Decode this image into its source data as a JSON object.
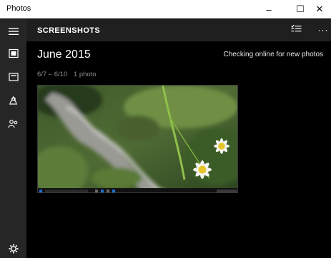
{
  "window": {
    "title": "Photos",
    "minimize_glyph": "–",
    "maximize_glyph": "☐",
    "close_glyph": "✕"
  },
  "sidebar": {
    "items": [
      {
        "name": "hamburger-menu-icon"
      },
      {
        "name": "collection-icon"
      },
      {
        "name": "albums-icon"
      },
      {
        "name": "people-icon"
      },
      {
        "name": "folders-icon"
      }
    ],
    "settings": {
      "name": "settings-icon"
    }
  },
  "header": {
    "title": "SCREENSHOTS",
    "select_icon": "select-icon",
    "more_glyph": "···"
  },
  "main": {
    "month_title": "June 2015",
    "status_text": "Checking online for new photos",
    "date_range": "6/7 – 6/10",
    "photo_count": "1 photo"
  },
  "colors": {
    "sidebar_bg": "#262626",
    "header_bg": "#1f1f1f",
    "content_bg": "#000000"
  }
}
